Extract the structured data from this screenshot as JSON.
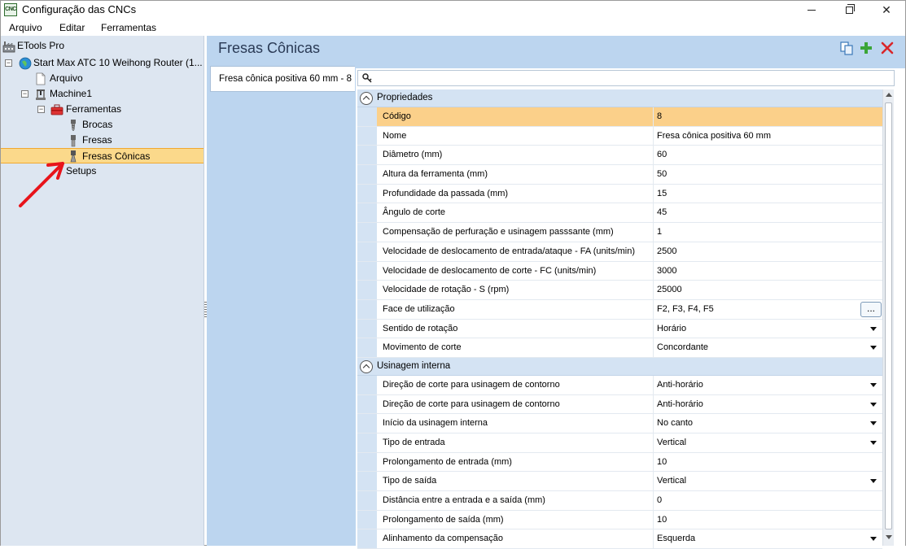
{
  "window": {
    "title": "Configuração das CNCs",
    "app_icon_text": "CNC"
  },
  "menu": [
    "Arquivo",
    "Editar",
    "Ferramentas"
  ],
  "tree": {
    "root": "ETools Pro",
    "machine_profile": "Start Max ATC 10 Weihong Router (1...",
    "arquivo": "Arquivo",
    "machine": "Machine1",
    "ferramentas": "Ferramentas",
    "brocas": "Brocas",
    "fresas": "Fresas",
    "fresas_conicas": "Fresas Cônicas",
    "setups": "Setups"
  },
  "panel": {
    "title": "Fresas Cônicas",
    "list_items": [
      "Fresa cônica positiva 60 mm - 8"
    ]
  },
  "properties": {
    "category_1": "Propriedades",
    "rows_1": [
      {
        "name": "Código",
        "value": "8"
      },
      {
        "name": "Nome",
        "value": "Fresa cônica positiva 60 mm"
      },
      {
        "name": "Diâmetro (mm)",
        "value": "60"
      },
      {
        "name": "Altura da ferramenta (mm)",
        "value": "50"
      },
      {
        "name": "Profundidade da passada (mm)",
        "value": "15"
      },
      {
        "name": "Ângulo de corte",
        "value": "45"
      },
      {
        "name": "Compensação de perfuração e usinagem passsante (mm)",
        "value": "1"
      },
      {
        "name": "Velocidade de deslocamento de entrada/ataque - FA (units/min)",
        "value": "2500"
      },
      {
        "name": "Velocidade de deslocamento de corte - FC (units/min)",
        "value": "3000"
      },
      {
        "name": "Velocidade de rotação - S (rpm)",
        "value": "25000"
      },
      {
        "name": "Face de utilização",
        "value": "F2, F3, F4, F5"
      },
      {
        "name": "Sentido de rotação",
        "value": "Horário"
      },
      {
        "name": "Movimento de corte",
        "value": "Concordante"
      }
    ],
    "category_2": "Usinagem interna",
    "rows_2": [
      {
        "name": "Direção de corte para usinagem de contorno",
        "value": "Anti-horário"
      },
      {
        "name": "Direção de corte para usinagem de contorno",
        "value": "Anti-horário"
      },
      {
        "name": "Início da usinagem interna",
        "value": "No canto"
      },
      {
        "name": "Tipo de entrada",
        "value": "Vertical"
      },
      {
        "name": "Prolongamento de entrada (mm)",
        "value": "10"
      },
      {
        "name": "Tipo de saída",
        "value": "Vertical"
      },
      {
        "name": "Distância entre a entrada e a saída (mm)",
        "value": "0"
      },
      {
        "name": "Prolongamento de saída (mm)",
        "value": "10"
      },
      {
        "name": "Alinhamento da compensação",
        "value": "Esquerda"
      }
    ],
    "ellipsis_label": "..."
  },
  "colors": {
    "tree_bg": "#dde6f1",
    "panel_bg": "#bcd5ef",
    "selected_highlight": "#fbd98b",
    "annotation_arrow": "#e8141b",
    "add_icon": "#3aa537",
    "delete_icon": "#d9262a"
  }
}
